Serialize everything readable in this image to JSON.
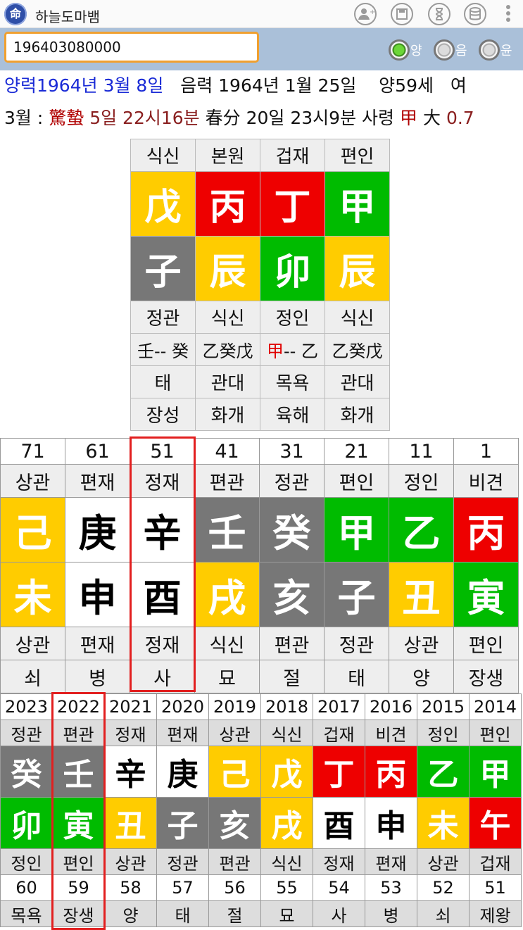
{
  "app": {
    "icon_char": "命",
    "title": "하늘도마뱀"
  },
  "toolbar": {
    "icons": [
      "add-user-icon",
      "save-icon",
      "hourglass-icon",
      "database-icon",
      "more-vert-icon"
    ]
  },
  "input": {
    "value": "196403080000"
  },
  "radios": [
    {
      "label": "양",
      "selected": true
    },
    {
      "label": "음",
      "selected": false
    },
    {
      "label": "윤",
      "selected": false
    }
  ],
  "info": {
    "solar": "양력1964년 3월 8일",
    "lunar": "음력 1964년 1월 25일",
    "age": "양59세",
    "gender": "여",
    "month_prefix": "3월 :",
    "term1_name": "驚蟄",
    "term1_time": "5일 22시16분",
    "term2_name": "春分",
    "term2_time": "20일 23시9분",
    "saryeong_label": "사령",
    "saryeong_char": "甲",
    "daeun_dir": "大",
    "daeun_num": "0.7"
  },
  "main": {
    "top_labels": [
      "식신",
      "본원",
      "겁재",
      "편인"
    ],
    "stems": [
      {
        "char": "戊",
        "color": "yellow"
      },
      {
        "char": "丙",
        "color": "red"
      },
      {
        "char": "丁",
        "color": "red"
      },
      {
        "char": "甲",
        "color": "green"
      }
    ],
    "branches": [
      {
        "char": "子",
        "color": "gray"
      },
      {
        "char": "辰",
        "color": "yellow"
      },
      {
        "char": "卯",
        "color": "green"
      },
      {
        "char": "辰",
        "color": "yellow"
      }
    ],
    "branch_labels": [
      "정관",
      "식신",
      "정인",
      "식신"
    ],
    "hidden": [
      {
        "pre": "",
        "mark": "",
        "post": "壬-- 癸"
      },
      {
        "pre": "",
        "mark": "",
        "post": "乙癸戊"
      },
      {
        "pre": "",
        "mark": "甲",
        "post": "-- 乙"
      },
      {
        "pre": "",
        "mark": "",
        "post": "乙癸戊"
      }
    ],
    "stages": [
      "태",
      "관대",
      "목욕",
      "관대"
    ],
    "spirits": [
      "장성",
      "화개",
      "육해",
      "화개"
    ]
  },
  "daeun": {
    "ages": [
      "71",
      "61",
      "51",
      "41",
      "31",
      "21",
      "11",
      "1"
    ],
    "top_labels": [
      "상관",
      "편재",
      "정재",
      "편관",
      "정관",
      "편인",
      "정인",
      "비견"
    ],
    "stems": [
      {
        "char": "己",
        "color": "yellow"
      },
      {
        "char": "庚",
        "color": "white"
      },
      {
        "char": "辛",
        "color": "white"
      },
      {
        "char": "壬",
        "color": "gray"
      },
      {
        "char": "癸",
        "color": "gray"
      },
      {
        "char": "甲",
        "color": "green"
      },
      {
        "char": "乙",
        "color": "green"
      },
      {
        "char": "丙",
        "color": "red"
      }
    ],
    "branches": [
      {
        "char": "未",
        "color": "yellow"
      },
      {
        "char": "申",
        "color": "white"
      },
      {
        "char": "酉",
        "color": "white"
      },
      {
        "char": "戌",
        "color": "yellow"
      },
      {
        "char": "亥",
        "color": "gray"
      },
      {
        "char": "子",
        "color": "gray"
      },
      {
        "char": "丑",
        "color": "yellow"
      },
      {
        "char": "寅",
        "color": "green"
      }
    ],
    "bottom_labels": [
      "상관",
      "편재",
      "정재",
      "식신",
      "편관",
      "정관",
      "상관",
      "편인"
    ],
    "stages": [
      "쇠",
      "병",
      "사",
      "묘",
      "절",
      "태",
      "양",
      "장생"
    ]
  },
  "yearly": {
    "years": [
      "2023",
      "2022",
      "2021",
      "2020",
      "2019",
      "2018",
      "2017",
      "2016",
      "2015",
      "2014"
    ],
    "top_labels": [
      "정관",
      "편관",
      "정재",
      "편재",
      "상관",
      "식신",
      "겁재",
      "비견",
      "정인",
      "편인"
    ],
    "stems": [
      {
        "char": "癸",
        "color": "gray"
      },
      {
        "char": "壬",
        "color": "gray"
      },
      {
        "char": "辛",
        "color": "white"
      },
      {
        "char": "庚",
        "color": "white"
      },
      {
        "char": "己",
        "color": "yellow"
      },
      {
        "char": "戊",
        "color": "yellow"
      },
      {
        "char": "丁",
        "color": "red"
      },
      {
        "char": "丙",
        "color": "red"
      },
      {
        "char": "乙",
        "color": "green"
      },
      {
        "char": "甲",
        "color": "green"
      }
    ],
    "branches": [
      {
        "char": "卯",
        "color": "green"
      },
      {
        "char": "寅",
        "color": "green"
      },
      {
        "char": "丑",
        "color": "yellow"
      },
      {
        "char": "子",
        "color": "gray"
      },
      {
        "char": "亥",
        "color": "gray"
      },
      {
        "char": "戌",
        "color": "yellow"
      },
      {
        "char": "酉",
        "color": "white"
      },
      {
        "char": "申",
        "color": "white"
      },
      {
        "char": "未",
        "color": "yellow"
      },
      {
        "char": "午",
        "color": "red"
      }
    ],
    "bottom_labels": [
      "정인",
      "편인",
      "상관",
      "정관",
      "편관",
      "식신",
      "정재",
      "편재",
      "상관",
      "겁재"
    ],
    "ages": [
      "60",
      "59",
      "58",
      "57",
      "56",
      "55",
      "54",
      "53",
      "52",
      "51"
    ],
    "stages": [
      "목욕",
      "장생",
      "양",
      "태",
      "절",
      "묘",
      "사",
      "병",
      "쇠",
      "제왕"
    ]
  },
  "colors": {
    "yellow": "#ffcc00",
    "red": "#ee0000",
    "green": "#00bb00",
    "gray": "#777777",
    "white": "#ffffff",
    "highlight": "#e21f1f",
    "input_border": "#f0a030",
    "toolbar_bg": "#aac0d9"
  }
}
